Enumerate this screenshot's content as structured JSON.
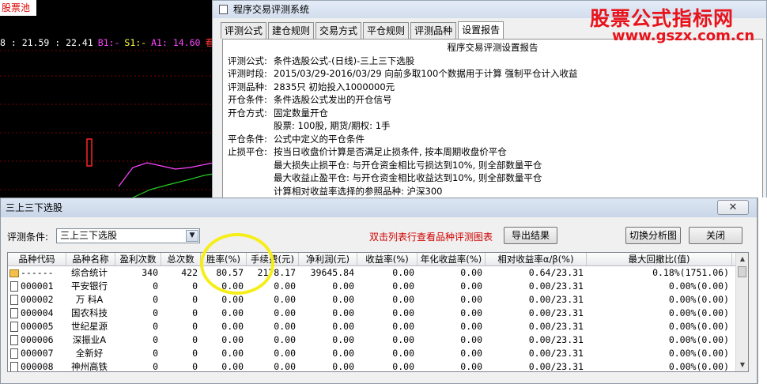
{
  "chart": {
    "title": "股票池",
    "legend": [
      {
        "text": "8 : 21.59 : 22.41",
        "color": "#ffffff"
      },
      {
        "text": "B1:-",
        "color": "#ff44ff"
      },
      {
        "text": "S1:-",
        "color": "#ffff44"
      },
      {
        "text": "A1: 14.60",
        "color": "#ff44ff"
      },
      {
        "text": "看多",
        "color": "#ff3333"
      }
    ]
  },
  "watermark": {
    "title": "股票公式指标网",
    "url": "www.gszx.com.cn"
  },
  "report_window": {
    "title": "程序交易评测系统",
    "tabs": [
      "评测公式",
      "建仓规则",
      "交易方式",
      "平仓规则",
      "评测品种",
      "设置报告"
    ],
    "active_tab": 5,
    "heading": "程序交易评测设置报告",
    "rows": [
      {
        "k": "评测公式:",
        "v": "条件选股公式-(日线)-三上三下选股"
      },
      {
        "k": "评测时段:",
        "v": "2015/03/29-2016/03/29 向前多取100个数据用于计算 强制平仓计入收益"
      },
      {
        "k": "评测品种:",
        "v": "2835只 初始投入1000000元"
      },
      {
        "k": "开仓条件:",
        "v": "条件选股公式发出的开仓信号"
      },
      {
        "k": "开仓方式:",
        "v": "固定数量开仓"
      }
    ],
    "indent_row": "股票: 100股, 期货/期权: 1手",
    "rows2": [
      {
        "k": "平仓条件:",
        "v": "公式中定义的平仓条件"
      },
      {
        "k": "止损平仓:",
        "v": "按当日收盘价计算是否满足止损条件, 按本周期收盘价平仓"
      }
    ],
    "indent_rows2": [
      "最大损失止损平仓: 与开仓资金相比亏损达到10%, 则全部数量平仓",
      "最大收益止盈平仓: 与开仓资金相比收益达到10%, 则全部数量平仓",
      "计算相对收益率选择的参照品种: 沪深300"
    ]
  },
  "result_window": {
    "title": "三上三下选股",
    "close_glyph": "✕",
    "condition_label": "评测条件:",
    "condition_value": "三上三下选股",
    "hint": "双击列表行查看品种评测图表",
    "buttons": {
      "export": "导出结果",
      "switch": "切换分析图",
      "close": "关闭"
    },
    "columns": [
      "品种代码",
      "品种名称",
      "盈利次数",
      "总次数",
      "胜率(%)",
      "手续费(元)",
      "净利润(元)",
      "收益率(%)",
      "年化收益率(%)",
      "相对收益率α/β(%)",
      "最大回撤比(值)"
    ],
    "rows": [
      {
        "code": "------",
        "name": "综合统计",
        "wins": "340",
        "total": "422",
        "rate": "80.57",
        "fee": "2178.17",
        "profit": "39645.84",
        "ret": "0.00",
        "annual": "0.00",
        "rel": "0.64/23.31",
        "dd": "0.18%(1751.06)",
        "icon": "folder"
      },
      {
        "code": "000001",
        "name": "平安银行",
        "wins": "0",
        "total": "0",
        "rate": "0.00",
        "fee": "0.00",
        "profit": "0.00",
        "ret": "0.00",
        "annual": "0.00",
        "rel": "0.00/23.31",
        "dd": "0.00%(0.00)",
        "icon": "doc"
      },
      {
        "code": "000002",
        "name": "万 科A",
        "wins": "0",
        "total": "0",
        "rate": "0.00",
        "fee": "0.00",
        "profit": "0.00",
        "ret": "0.00",
        "annual": "0.00",
        "rel": "0.00/23.31",
        "dd": "0.00%(0.00)",
        "icon": "doc"
      },
      {
        "code": "000004",
        "name": "国农科技",
        "wins": "0",
        "total": "0",
        "rate": "0.00",
        "fee": "0.00",
        "profit": "0.00",
        "ret": "0.00",
        "annual": "0.00",
        "rel": "0.00/23.31",
        "dd": "0.00%(0.00)",
        "icon": "doc"
      },
      {
        "code": "000005",
        "name": "世纪星源",
        "wins": "0",
        "total": "0",
        "rate": "0.00",
        "fee": "0.00",
        "profit": "0.00",
        "ret": "0.00",
        "annual": "0.00",
        "rel": "0.00/23.31",
        "dd": "0.00%(0.00)",
        "icon": "doc"
      },
      {
        "code": "000006",
        "name": "深振业A",
        "wins": "0",
        "total": "0",
        "rate": "0.00",
        "fee": "0.00",
        "profit": "0.00",
        "ret": "0.00",
        "annual": "0.00",
        "rel": "0.00/23.31",
        "dd": "0.00%(0.00)",
        "icon": "doc"
      },
      {
        "code": "000007",
        "name": "全新好",
        "wins": "0",
        "total": "0",
        "rate": "0.00",
        "fee": "0.00",
        "profit": "0.00",
        "ret": "0.00",
        "annual": "0.00",
        "rel": "0.00/23.31",
        "dd": "0.00%(0.00)",
        "icon": "doc"
      },
      {
        "code": "000008",
        "name": "神州高铁",
        "wins": "0",
        "total": "0",
        "rate": "0.00",
        "fee": "0.00",
        "profit": "0.00",
        "ret": "0.00",
        "annual": "0.00",
        "rel": "0.00/23.31",
        "dd": "0.00%(0.00)",
        "icon": "doc"
      }
    ]
  },
  "colors": {
    "highlight": "#f6ee1a",
    "hint_red": "#d00000",
    "watermark_red": "#e8131b",
    "chart_magenta": "#ff44ff",
    "chart_green": "#22cc22"
  }
}
